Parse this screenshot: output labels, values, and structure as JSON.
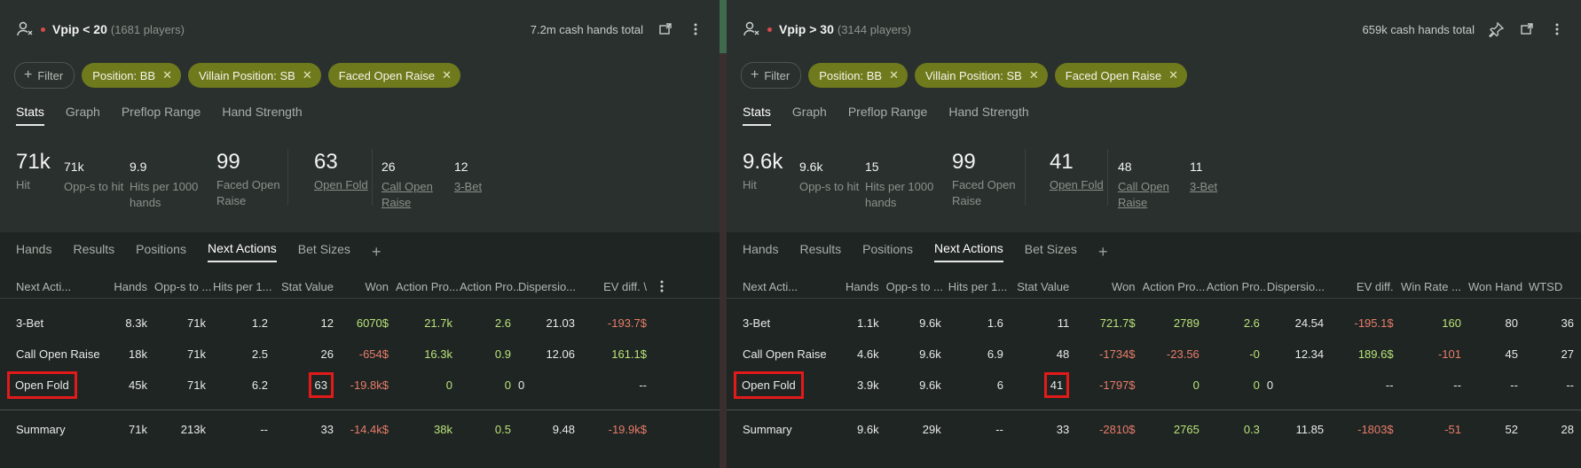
{
  "panels": [
    {
      "title": "Vpip < 20",
      "subtitle": "(1681 players)",
      "hands_total": "7.2m cash hands total",
      "filter_label": "Filter",
      "chips": [
        "Position: BB",
        "Villain Position: SB",
        "Faced Open Raise"
      ],
      "tabs": [
        "Stats",
        "Graph",
        "Preflop Range",
        "Hand Strength"
      ],
      "stats": {
        "hit": {
          "value": "71k",
          "label": "Hit"
        },
        "opps": {
          "value": "71k",
          "label": "Opp-s to hit"
        },
        "hits1000": {
          "value": "9.9",
          "label1": "Hits per 1000",
          "label2": "hands"
        },
        "faced": {
          "value": "99",
          "label1": "Faced Open",
          "label2": "Raise"
        },
        "openfold": {
          "value": "63",
          "label": "Open Fold"
        },
        "callopen": {
          "value": "26",
          "label1": "Call Open",
          "label2": "Raise"
        },
        "threebet": {
          "value": "12",
          "label": "3-Bet"
        }
      },
      "subtabs": [
        "Hands",
        "Results",
        "Positions",
        "Next Actions",
        "Bet Sizes"
      ],
      "columns": [
        "Next Acti...",
        "Hands",
        "Opp-s to ...",
        "Hits per 1...",
        "Stat Value",
        "Won",
        "Action Pro...",
        "Action Pro...",
        "Dispersio...",
        "EV diff. \\"
      ],
      "rows": [
        [
          "3-Bet",
          "8.3k",
          "71k",
          "1.2",
          "12",
          "6070$",
          "21.7k",
          "2.6",
          "21.03",
          "-193.7$"
        ],
        [
          "Call Open Raise",
          "18k",
          "71k",
          "2.5",
          "26",
          "-654$",
          "16.3k",
          "0.9",
          "12.06",
          "161.1$"
        ],
        [
          "Open Fold",
          "45k",
          "71k",
          "6.2",
          "63",
          "-19.8k$",
          "0",
          "0",
          "0",
          "--"
        ]
      ],
      "summary": [
        "Summary",
        "71k",
        "213k",
        "--",
        "33",
        "-14.4k$",
        "38k",
        "0.5",
        "9.48",
        "-19.9k$"
      ]
    },
    {
      "title": "Vpip > 30",
      "subtitle": "(3144 players)",
      "hands_total": "659k cash hands total",
      "filter_label": "Filter",
      "chips": [
        "Position: BB",
        "Villain Position: SB",
        "Faced Open Raise"
      ],
      "tabs": [
        "Stats",
        "Graph",
        "Preflop Range",
        "Hand Strength"
      ],
      "stats": {
        "hit": {
          "value": "9.6k",
          "label": "Hit"
        },
        "opps": {
          "value": "9.6k",
          "label": "Opp-s to hit"
        },
        "hits1000": {
          "value": "15",
          "label1": "Hits per 1000",
          "label2": "hands"
        },
        "faced": {
          "value": "99",
          "label1": "Faced Open",
          "label2": "Raise"
        },
        "openfold": {
          "value": "41",
          "label": "Open Fold"
        },
        "callopen": {
          "value": "48",
          "label1": "Call Open",
          "label2": "Raise"
        },
        "threebet": {
          "value": "11",
          "label": "3-Bet"
        }
      },
      "subtabs": [
        "Hands",
        "Results",
        "Positions",
        "Next Actions",
        "Bet Sizes"
      ],
      "columns": [
        "Next Acti...",
        "Hands",
        "Opp-s to ...",
        "Hits per 1...",
        "Stat Value",
        "Won",
        "Action Pro...",
        "Action Pro...",
        "Dispersio...",
        "EV diff.",
        "Win Rate ...",
        "Won Hand",
        "WTSD"
      ],
      "rows": [
        [
          "3-Bet",
          "1.1k",
          "9.6k",
          "1.6",
          "11",
          "721.7$",
          "2789",
          "2.6",
          "24.54",
          "-195.1$",
          "160",
          "80",
          "36"
        ],
        [
          "Call Open Raise",
          "4.6k",
          "9.6k",
          "6.9",
          "48",
          "-1734$",
          "-23.56",
          "-0",
          "12.34",
          "189.6$",
          "-101",
          "45",
          "27"
        ],
        [
          "Open Fold",
          "3.9k",
          "9.6k",
          "6",
          "41",
          "-1797$",
          "0",
          "0",
          "0",
          "--",
          "--",
          "--",
          "--"
        ]
      ],
      "summary": [
        "Summary",
        "9.6k",
        "29k",
        "--",
        "33",
        "-2810$",
        "2765",
        "0.3",
        "11.85",
        "-1803$",
        "-51",
        "52",
        "28"
      ]
    }
  ],
  "colors": {
    "chip": "#6f7a1d",
    "positive": "#b9e37a",
    "negative": "#e87c6b",
    "highlight": "#e21a1a"
  }
}
